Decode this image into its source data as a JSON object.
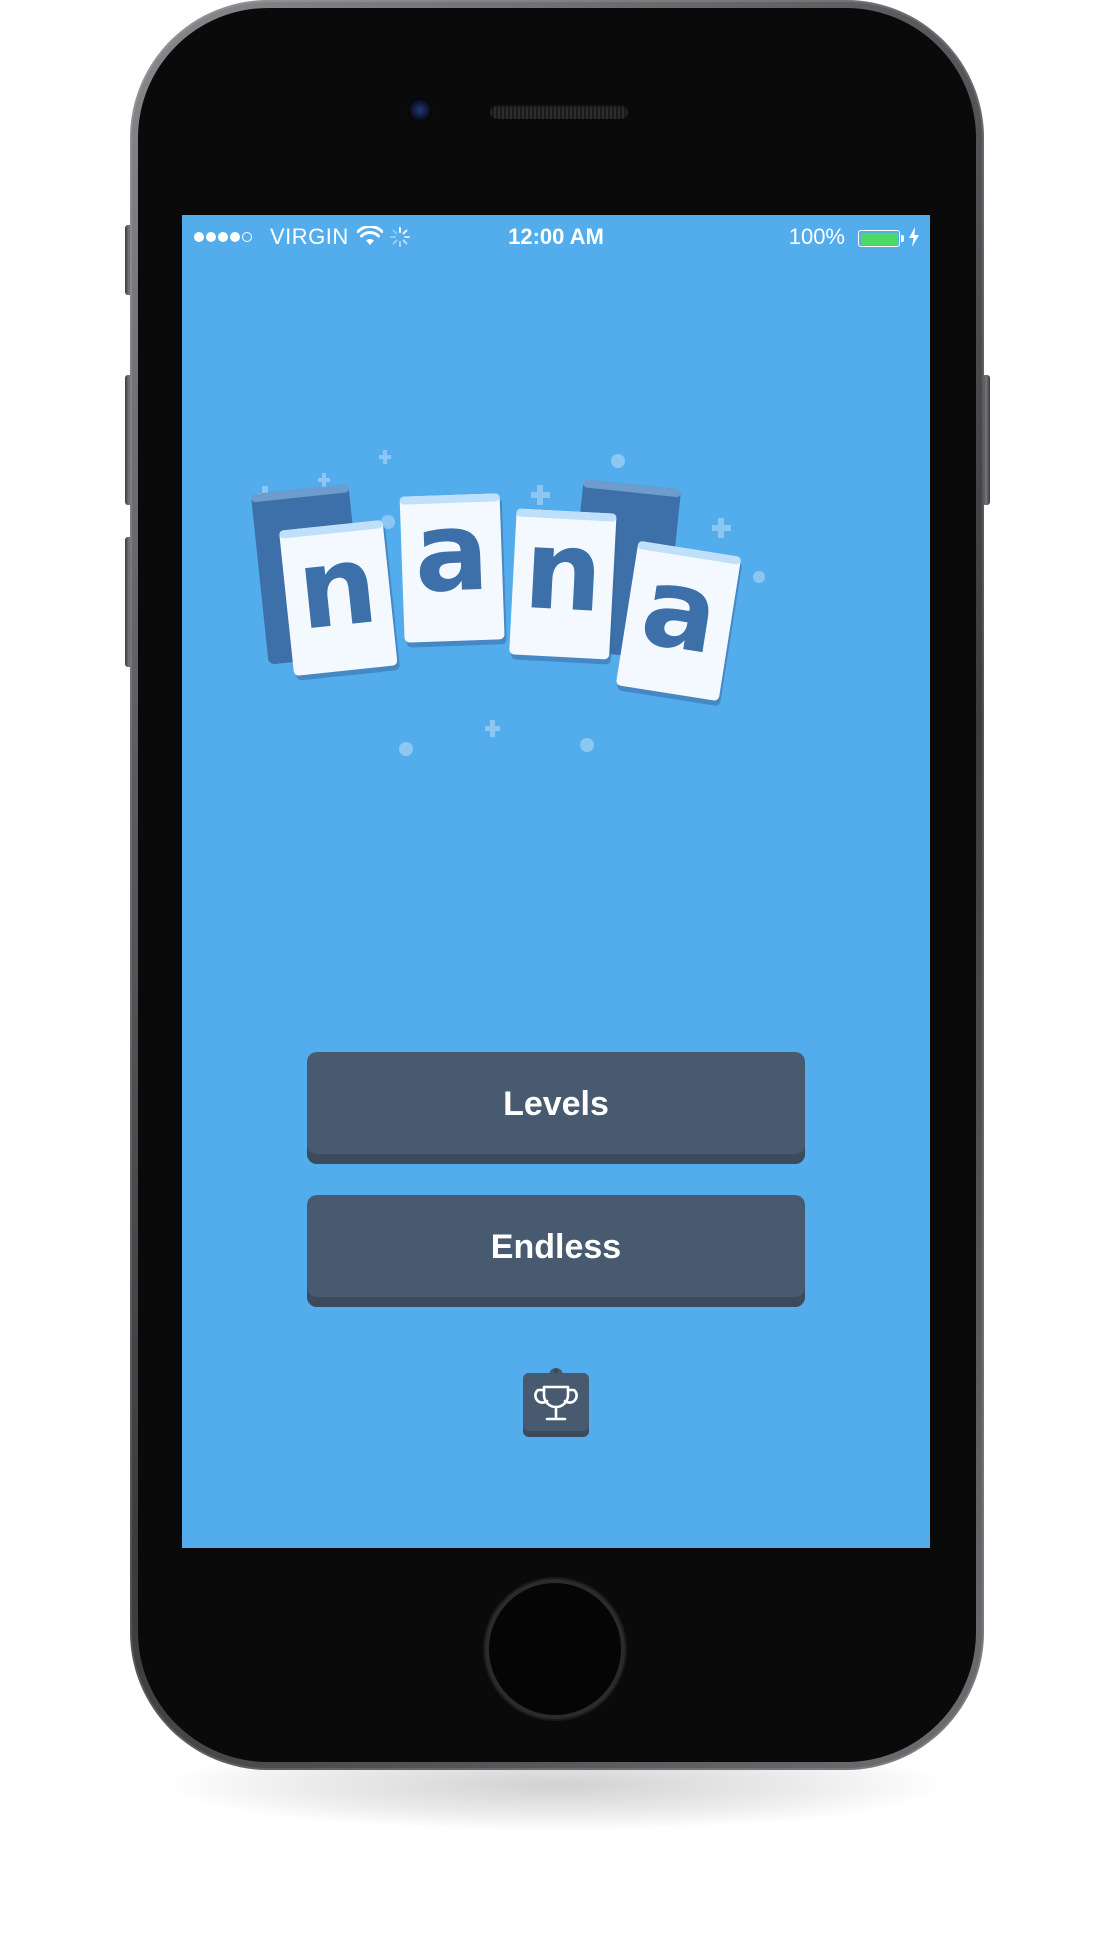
{
  "status_bar": {
    "signal_bars": 5,
    "signal_filled": 4,
    "carrier": "VIRGIN",
    "time": "12:00 AM",
    "battery_percent": "100%",
    "battery_level": 1.0,
    "battery_color": "#4cd964"
  },
  "logo": {
    "letters": [
      "n",
      "a",
      "n",
      "a"
    ]
  },
  "menu": {
    "levels_label": "Levels",
    "endless_label": "Endless"
  },
  "icons": {
    "leaderboard": "trophy-icon",
    "wifi": "wifi-icon",
    "activity": "activity-spinner-icon",
    "charging": "lightning-icon"
  },
  "colors": {
    "background": "#53aded",
    "button": "#485a6f",
    "card": "#ffffff",
    "card_back": "#3d6fa8",
    "letter": "#3d6fa8"
  }
}
